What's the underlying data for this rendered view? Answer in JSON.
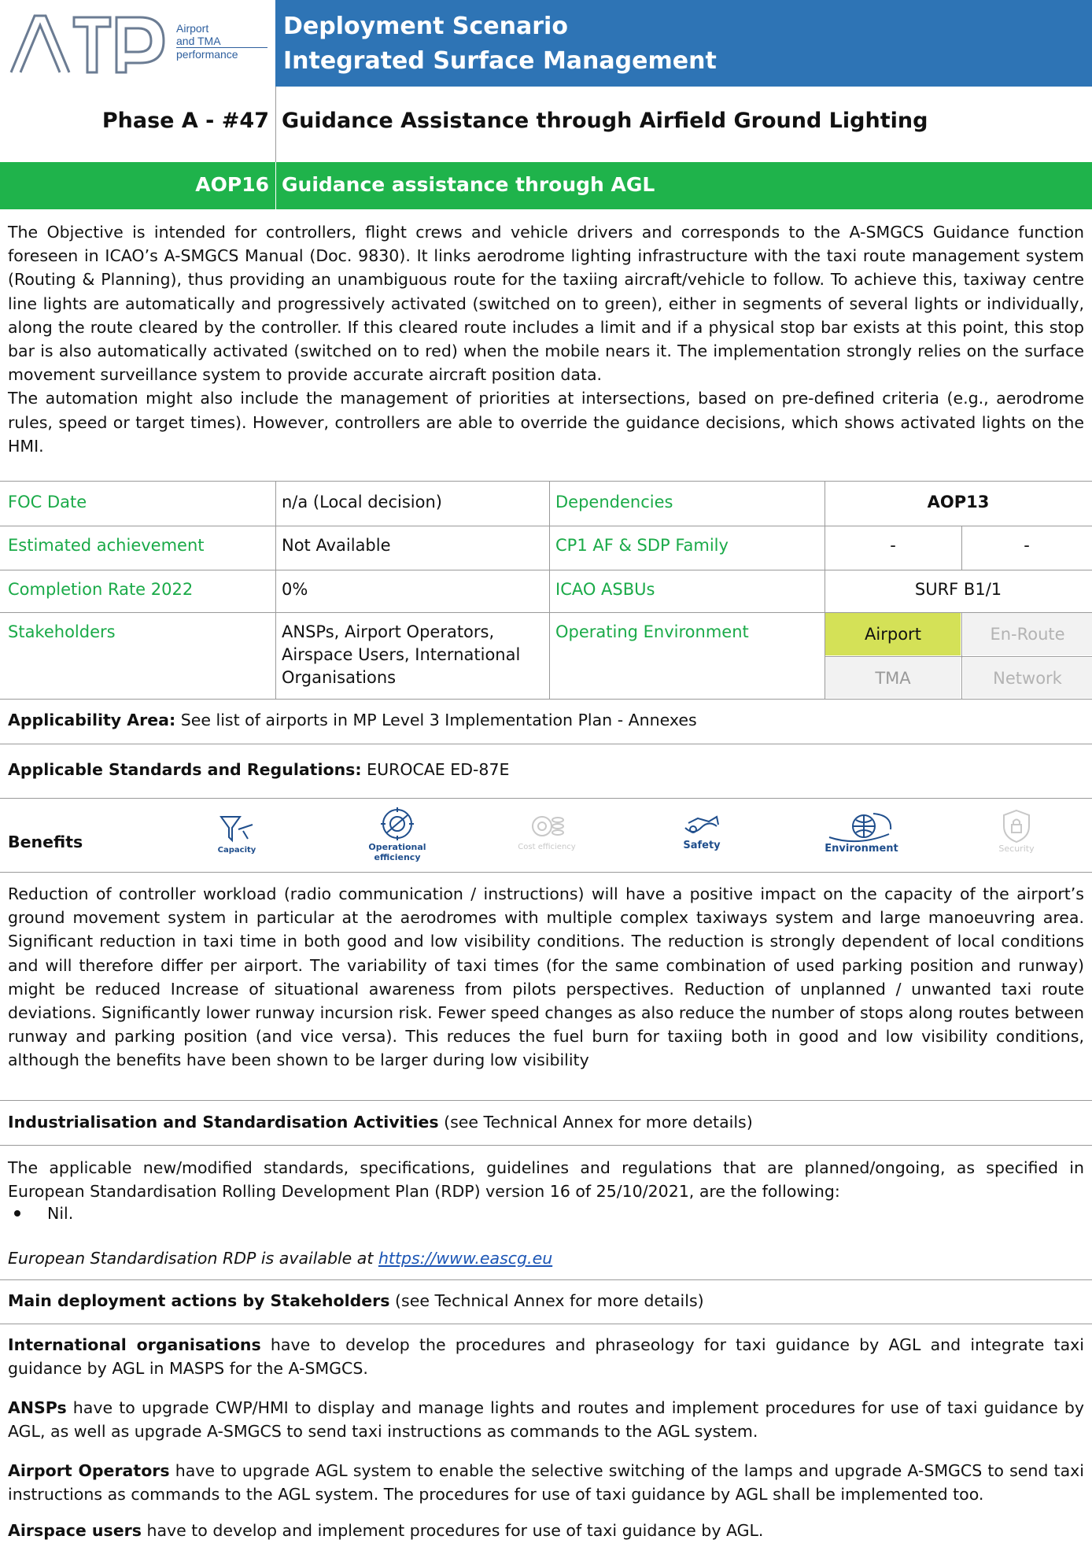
{
  "logo": {
    "mark": "ATp",
    "lines": [
      "Airport",
      "and TMA",
      "performance"
    ]
  },
  "header": {
    "title_line1": "Deployment Scenario",
    "title_line2": "Integrated Surface Management",
    "color": "#2e74b5"
  },
  "phase": {
    "code": "Phase A - #47",
    "title": "Guidance Assistance through Airfield Ground Lighting"
  },
  "objective": {
    "code": "AOP16",
    "title": "Guidance assistance through AGL",
    "color": "#1fb34b"
  },
  "description": {
    "p1": "The Objective is intended for controllers, flight crews and vehicle drivers and corresponds to the A-SMGCS Guidance function foreseen in ICAO’s A-SMGCS Manual (Doc. 9830). It links aerodrome lighting infrastructure with the taxi route management system (Routing & Planning), thus providing an unambiguous route for the taxiing aircraft/vehicle to follow. To achieve this, taxiway centre line lights are automatically and progressively activated (switched on to green), either in segments of several lights or individually, along the route cleared by the controller. If this cleared route includes a limit and if a physical stop bar exists at this point, this stop bar is also automatically activated (switched on to red) when the mobile nears it. The implementation strongly relies on the surface movement surveillance system to provide accurate aircraft position data.",
    "p2": "The automation might also include the management of priorities at intersections, based on pre-defined criteria (e.g., aerodrome rules, speed or target times). However, controllers are able to override the guidance decisions, which shows activated lights on the HMI."
  },
  "info": {
    "foc_label": "FOC Date",
    "foc_value": "n/a (Local decision)",
    "dep_label": "Dependencies",
    "dep_value": "AOP13",
    "est_label": "Estimated achievement",
    "est_value": "Not Available",
    "cp1_label": "CP1 AF & SDP Family",
    "cp1_value1": "-",
    "cp1_value2": "-",
    "comp_label": "Completion Rate 2022",
    "comp_value": "0%",
    "icao_label": "ICAO ASBUs",
    "icao_value": "SURF B1/1",
    "stake_label": "Stakeholders",
    "stake_value": "ANSPs, Airport Operators, Airspace Users, International Organisations",
    "env_label": "Operating Environment",
    "env": {
      "airport": "Airport",
      "enroute": "En-Route",
      "tma": "TMA",
      "network": "Network"
    },
    "env_active_color": "#d4e157"
  },
  "applicability": {
    "label": "Applicability Area:",
    "text": "See list of airports in MP Level 3 Implementation Plan - Annexes"
  },
  "standards": {
    "label": "Applicable Standards and Regulations:",
    "text": "EUROCAE ED-87E"
  },
  "benefits": {
    "label": "Benefits",
    "icons": [
      {
        "name": "capacity-icon",
        "caption": "Capacity",
        "active": true
      },
      {
        "name": "operational-efficiency-icon",
        "caption": "Operational efficiency",
        "active": true
      },
      {
        "name": "cost-efficiency-icon",
        "caption": "Cost efficiency",
        "active": false
      },
      {
        "name": "safety-icon",
        "caption": "Safety",
        "active": true
      },
      {
        "name": "environment-icon",
        "caption": "Environment",
        "active": true
      },
      {
        "name": "security-icon",
        "caption": "Security",
        "active": false
      }
    ],
    "text": "Reduction of controller workload (radio communication / instructions) will have a positive impact on the capacity of the airport’s ground movement system in particular at the aerodromes with multiple complex taxiways system and large manoeuvring area. Significant reduction in taxi time in both good and low visibility conditions. The reduction is strongly dependent of local conditions and will therefore differ per airport. The variability of taxi times (for the same combination of used parking position and runway) might be reduced Increase of situational awareness from pilots perspectives. Reduction of unplanned / unwanted taxi route deviations. Significantly lower runway incursion risk. Fewer speed changes as also reduce the number of stops along routes between runway and parking position (and vice versa). This reduces the fuel burn for taxiing both in good and low visibility conditions, although the benefits have been shown to be larger during low visibility"
  },
  "industrialisation": {
    "label": "Industrialisation and Standardisation Activities",
    "note": "(see Technical Annex for more details)",
    "text": "The applicable new/modified standards, specifications, guidelines and regulations that are planned/ongoing, as specified in European Standardisation Rolling Development Plan (RDP) version 16 of 25/10/2021, are the following:",
    "bullet": "Nil.",
    "rdp_text": "European Standardisation RDP is available at",
    "rdp_link": "https://www.eascg.eu"
  },
  "actions": {
    "label": "Main deployment actions by Stakeholders",
    "note": "(see Technical Annex for more details)",
    "items": [
      {
        "who": "International organisations",
        "text": "have to develop the procedures and phraseology for taxi guidance by AGL and integrate taxi guidance by AGL in MASPS for the A-SMGCS."
      },
      {
        "who": "ANSPs",
        "text": "have to upgrade CWP/HMI to display and manage lights and routes and implement procedures for use of taxi guidance by AGL, as well as upgrade A-SMGCS to send taxi instructions as commands to the AGL system."
      },
      {
        "who": "Airport Operators",
        "text": "have to upgrade AGL system to enable the selective switching of the lamps and upgrade A-SMGCS to send taxi instructions as commands to the AGL system. The procedures for use of taxi guidance by AGL shall be implemented too."
      },
      {
        "who": "Airspace users",
        "text": "have to develop and implement procedures for use of taxi guidance by AGL."
      }
    ]
  }
}
